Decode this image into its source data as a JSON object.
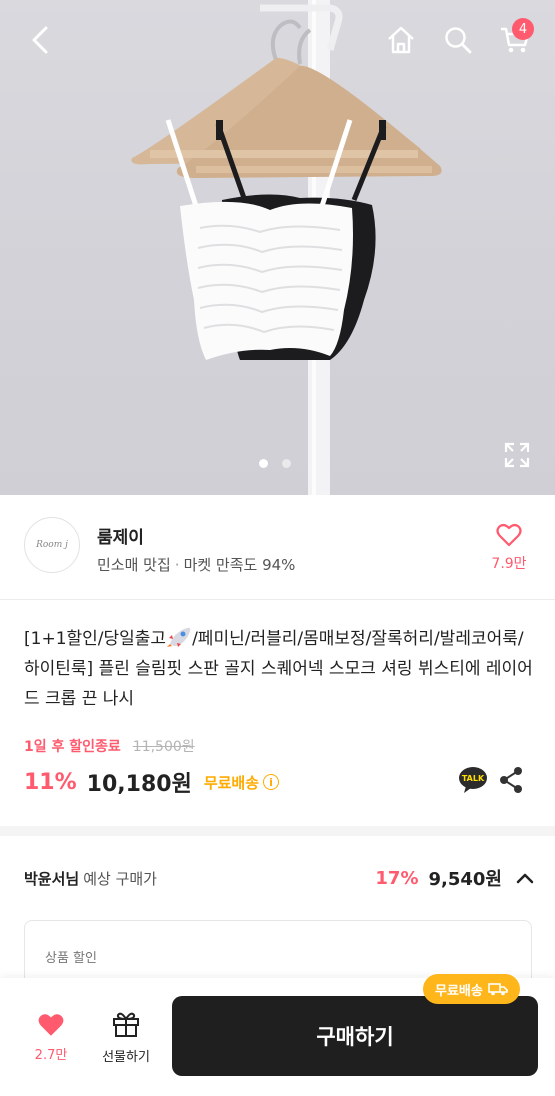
{
  "header": {
    "back_icon": "chevron-left-icon",
    "home_icon": "home-icon",
    "search_icon": "search-icon",
    "cart_icon": "cart-icon",
    "cart_count": "4"
  },
  "gallery": {
    "image_count": 2,
    "active_index": 0,
    "expand_icon": "expand-icon"
  },
  "seller": {
    "logo_text": "Room j",
    "name": "룸제이",
    "category": "민소매 맛집",
    "separator": "·",
    "satisfaction": "마켓 만족도 94%",
    "likes": "7.9만"
  },
  "product": {
    "title_before_icon": "[1+1할인/당일출고",
    "title_after_icon": "/페미닌/러블리/몸매보정/잘록허리/발레코어룩/하이틴룩] 플린 슬림핏 스판 골지 스퀘어넥 스모크 셔링 뷔스티에 레이어드 크롭 끈 나시",
    "deal_end": "1일 후 할인종료",
    "original_price": "11,500원",
    "discount": "11%",
    "price": "10,180원",
    "free_shipping": "무료배송",
    "info_icon": "i",
    "talk_label": "TALK"
  },
  "member_price": {
    "name": "박윤서님",
    "label": "예상 구매가",
    "discount": "17%",
    "price": "9,540원",
    "detail_label": "상품 할인"
  },
  "bottom_bar": {
    "likes": "2.7만",
    "gift_label": "선물하기",
    "buy_label": "구매하기",
    "free_ship_badge": "무료배송"
  },
  "colors": {
    "accent_pink": "#ff5a6e",
    "shipping_yellow": "#ffab00",
    "buy_button": "#1f1f1f"
  }
}
